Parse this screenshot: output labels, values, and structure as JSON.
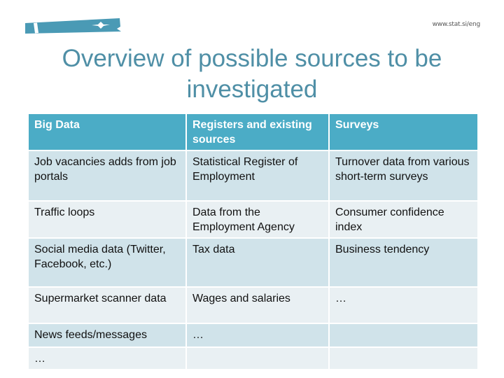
{
  "header": {
    "logo_icon": "stat-si-logo-icon",
    "url": "www.stat.si/eng",
    "brand_color": "#4a9ab5"
  },
  "slide": {
    "title": "Overview of possible sources to be investigated",
    "title_color": "#4f8fa6"
  },
  "table": {
    "header_color": "#4bacc6",
    "row_color_odd": "#d0e3ea",
    "row_color_even": "#e9f0f3",
    "columns": [
      "Big Data",
      "Registers and existing sources",
      "Surveys"
    ],
    "rows": [
      [
        "Job vacancies adds from job portals",
        "Statistical Register of Employment",
        "Turnover data from various short-term surveys"
      ],
      [
        "Traffic loops",
        "Data from the Employment Agency",
        "Consumer confidence index"
      ],
      [
        "Social media data (Twitter, Facebook, etc.)",
        "Tax data",
        "Business tendency"
      ],
      [
        "Supermarket scanner data",
        "Wages and salaries",
        "…"
      ],
      [
        "News feeds/messages",
        "…",
        ""
      ],
      [
        "…",
        "",
        ""
      ]
    ]
  }
}
